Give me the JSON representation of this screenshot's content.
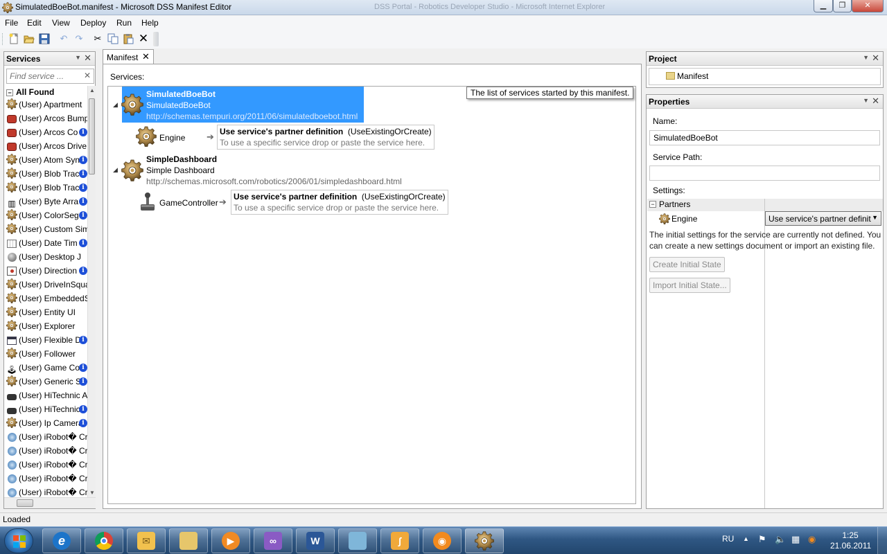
{
  "window": {
    "title": "SimulatedBoeBot.manifest - Microsoft DSS Manifest Editor",
    "background_tabs": "DSS Portal - Robotics Developer Studio - Microsoft Internet Explorer"
  },
  "menu": {
    "file": "File",
    "edit": "Edit",
    "view": "View",
    "deploy": "Deploy",
    "run": "Run",
    "help": "Help"
  },
  "toolbar": {
    "icons": [
      "new-icon",
      "open-icon",
      "save-icon",
      "undo-icon",
      "redo-icon",
      "cut-icon",
      "copy-icon",
      "paste-icon",
      "delete-icon"
    ]
  },
  "services_panel": {
    "title": "Services",
    "search_placeholder": "Find service ...",
    "group_label": "All Found",
    "items": [
      {
        "label": "(User) Apartment",
        "icon": "gear-icon",
        "info": false
      },
      {
        "label": "(User) Arcos Bumper",
        "icon": "red-robot-icon",
        "info": false
      },
      {
        "label": "(User) Arcos Co",
        "icon": "red-robot-icon",
        "info": true
      },
      {
        "label": "(User) Arcos Drive",
        "icon": "red-robot-icon",
        "info": false
      },
      {
        "label": "(User) Atom Syn",
        "icon": "gear-icon",
        "info": true
      },
      {
        "label": "(User) Blob Trac",
        "icon": "gear-icon",
        "info": true
      },
      {
        "label": "(User) Blob Trac",
        "icon": "gear-icon",
        "info": true
      },
      {
        "label": "(User) Byte Arra",
        "icon": "array-icon",
        "info": true
      },
      {
        "label": "(User) ColorSeg",
        "icon": "gear-icon",
        "info": true
      },
      {
        "label": "(User) Custom Sim",
        "icon": "gear-icon",
        "info": false
      },
      {
        "label": "(User) Date Tim",
        "icon": "calendar-icon",
        "info": true
      },
      {
        "label": "(User) Desktop J",
        "icon": "globe-icon",
        "info": false
      },
      {
        "label": "(User) Direction",
        "icon": "compass-icon",
        "info": true
      },
      {
        "label": "(User) DriveInSqua",
        "icon": "gear-icon",
        "info": false
      },
      {
        "label": "(User) EmbeddedS",
        "icon": "gear-icon",
        "info": false
      },
      {
        "label": "(User) Entity UI",
        "icon": "gear-icon",
        "info": false
      },
      {
        "label": "(User) Explorer",
        "icon": "gear-icon",
        "info": false
      },
      {
        "label": "(User) Flexible D",
        "icon": "window-icon",
        "info": true
      },
      {
        "label": "(User) Follower",
        "icon": "gear-icon",
        "info": false
      },
      {
        "label": "(User) Game Co",
        "icon": "joystick-icon",
        "info": true
      },
      {
        "label": "(User) Generic S",
        "icon": "gear-icon",
        "info": true
      },
      {
        "label": "(User) HiTechnic A",
        "icon": "sensor-icon",
        "info": false
      },
      {
        "label": "(User) HiTechnic",
        "icon": "sensor-icon",
        "info": true
      },
      {
        "label": "(User) Ip Camera",
        "icon": "gear-icon",
        "info": true
      },
      {
        "label": "(User) iRobot� Cr",
        "icon": "roomba-icon",
        "info": false
      },
      {
        "label": "(User) iRobot� Cr",
        "icon": "roomba-icon",
        "info": false
      },
      {
        "label": "(User) iRobot� Cr",
        "icon": "roomba-icon",
        "info": false
      },
      {
        "label": "(User) iRobot� Cr",
        "icon": "roomba-icon",
        "info": false
      },
      {
        "label": "(User) iRobot� Cr",
        "icon": "roomba-icon",
        "info": false
      }
    ]
  },
  "document": {
    "tab_label": "Manifest",
    "services_label": "Services:",
    "tooltip": "The list of services started by this manifest.",
    "services": [
      {
        "name": "SimulatedBoeBot",
        "display": "SimulatedBoeBot",
        "contract": "http://schemas.tempuri.org/2011/06/simulatedboebot.html",
        "partner": {
          "name": "Engine",
          "definition": "Use service's partner definition",
          "mode": "(UseExistingOrCreate)",
          "hint": "To use a specific service drop or paste the service here."
        }
      },
      {
        "name": "SimpleDashboard",
        "display": "Simple Dashboard",
        "contract": "http://schemas.microsoft.com/robotics/2006/01/simpledashboard.html",
        "partner": {
          "name": "GameController",
          "definition": "Use service's partner definition",
          "mode": "(UseExistingOrCreate)",
          "hint": "To use a specific service drop or paste the service here."
        }
      }
    ]
  },
  "project_panel": {
    "title": "Project",
    "item": "Manifest"
  },
  "properties_panel": {
    "title": "Properties",
    "name_label": "Name:",
    "name_value": "SimulatedBoeBot",
    "path_label": "Service Path:",
    "path_value": "",
    "settings_label": "Settings:",
    "partners_label": "Partners",
    "partner_name": "Engine",
    "partner_value": "Use service's partner definit",
    "note": "The initial settings for the service are currently not defined. You can create a new settings document or import an existing file.",
    "create_button": "Create Initial State",
    "import_button": "Import Initial State..."
  },
  "status": {
    "text": "Loaded"
  },
  "taskbar": {
    "language": "RU",
    "time": "1:25",
    "date": "21.06.2011",
    "apps": [
      "internet-explorer-icon",
      "chrome-icon",
      "outlook-icon",
      "explorer-icon",
      "media-player-icon",
      "visual-studio-icon",
      "word-icon",
      "notepad-icon",
      "paint-icon",
      "blender-icon",
      "dss-editor-icon"
    ]
  }
}
